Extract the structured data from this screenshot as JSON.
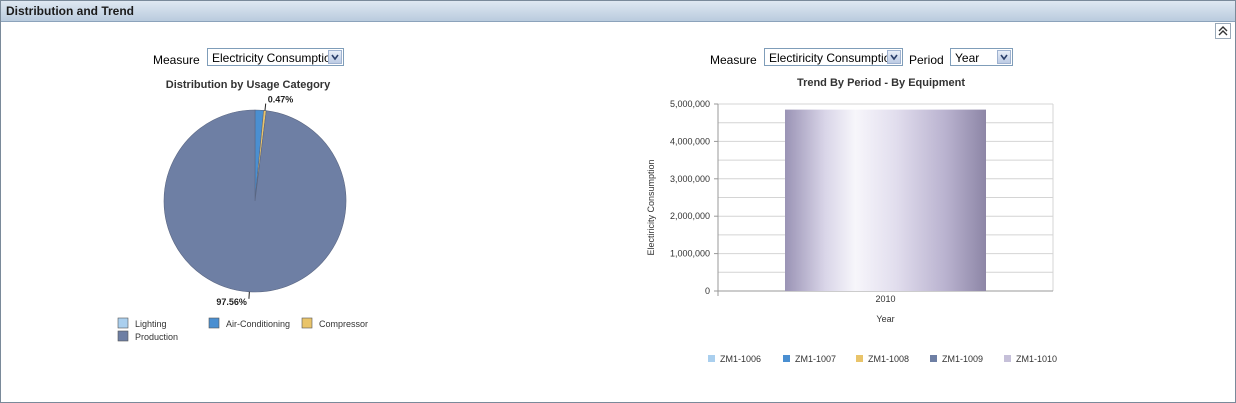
{
  "header": {
    "title": "Distribution and Trend"
  },
  "left": {
    "measure_label": "Measure",
    "measure_value": "Electricity Consumption"
  },
  "right": {
    "measure_label": "Measure",
    "measure_value": "Electiricity Consumption",
    "period_label": "Period",
    "period_value": "Year"
  },
  "chart_data": [
    {
      "type": "pie",
      "title": "Distribution by Usage Category",
      "categories": [
        "Lighting",
        "Air-Conditioning",
        "Compressor",
        "Production"
      ],
      "values": [
        0.0,
        1.5,
        0.47,
        97.56
      ],
      "colors": [
        "#aacfee",
        "#4a8fd1",
        "#e9c46a",
        "#6e7fa4"
      ],
      "data_labels": [
        {
          "category": "Compressor",
          "text": "0.47%"
        },
        {
          "category": "Production",
          "text": "97.56%"
        }
      ],
      "legend": "bottom"
    },
    {
      "type": "bar",
      "title": "Trend By Period - By Equipment",
      "categories": [
        "2010"
      ],
      "xlabel": "Year",
      "ylabel": "Electiricity Consumption",
      "ylim": [
        0,
        5000000
      ],
      "yticks": [
        "0",
        "1,000,000",
        "2,000,000",
        "3,000,000",
        "4,000,000",
        "5,000,000"
      ],
      "stacked": true,
      "series": [
        {
          "name": "ZM1-1006",
          "values": [
            0
          ],
          "color": "#aacfee"
        },
        {
          "name": "ZM1-1007",
          "values": [
            0
          ],
          "color": "#4a8fd1"
        },
        {
          "name": "ZM1-1008",
          "values": [
            0
          ],
          "color": "#e9c46a"
        },
        {
          "name": "ZM1-1009",
          "values": [
            0
          ],
          "color": "#6e7fa4"
        },
        {
          "name": "ZM1-1010",
          "values": [
            4850000
          ],
          "color": "#c6c0d9"
        }
      ],
      "legend": "bottom",
      "grid": true
    }
  ]
}
